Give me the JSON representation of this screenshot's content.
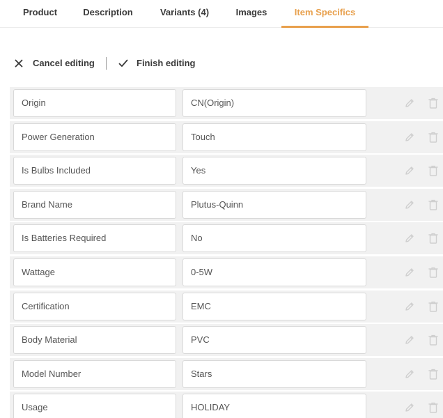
{
  "tabs": [
    {
      "label": "Product"
    },
    {
      "label": "Description"
    },
    {
      "label": "Variants (4)"
    },
    {
      "label": "Images"
    },
    {
      "label": "Item Specifics",
      "active": true
    }
  ],
  "toolbar": {
    "cancel_label": "Cancel editing",
    "finish_label": "Finish editing"
  },
  "colors": {
    "accent": "#e8a04d",
    "row_bg": "#f1f1f1",
    "icon": "#cfcfcf"
  },
  "specifics": [
    {
      "name": "Origin",
      "value": "CN(Origin)"
    },
    {
      "name": "Power Generation",
      "value": "Touch"
    },
    {
      "name": "Is Bulbs Included",
      "value": "Yes"
    },
    {
      "name": "Brand Name",
      "value": "Plutus-Quinn"
    },
    {
      "name": "Is Batteries Required",
      "value": "No"
    },
    {
      "name": "Wattage",
      "value": "0-5W"
    },
    {
      "name": "Certification",
      "value": "EMC"
    },
    {
      "name": "Body Material",
      "value": "PVC"
    },
    {
      "name": "Model Number",
      "value": "Stars"
    },
    {
      "name": "Usage",
      "value": "HOLIDAY"
    }
  ],
  "icons": {
    "cancel": "close-icon",
    "finish": "checkmark-icon",
    "row_edit": "pencil-icon",
    "row_delete": "trash-icon"
  }
}
